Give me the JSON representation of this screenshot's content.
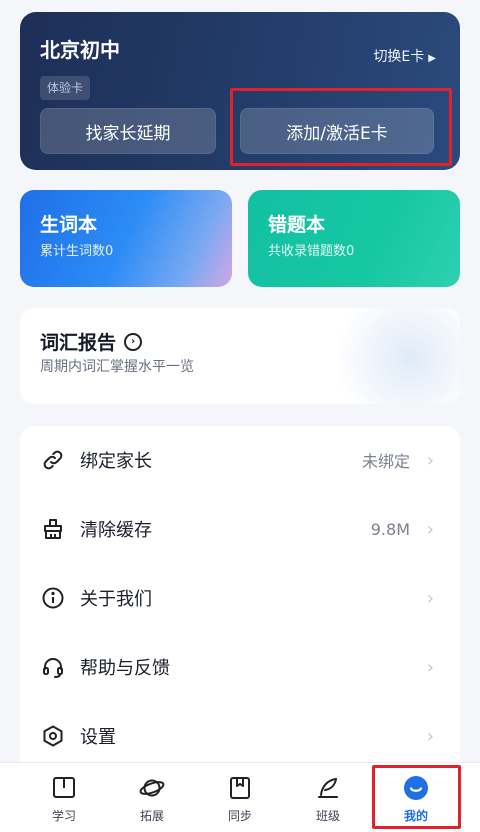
{
  "ecard": {
    "school_name": "北京初中",
    "card_type_tag": "体验卡",
    "switch_label": "切换E卡",
    "find_parent_extend_label": "找家长延期",
    "add_activate_label": "添加/激活E卡"
  },
  "books": {
    "vocab": {
      "title": "生词本",
      "subtitle": "累计生词数0"
    },
    "mistakes": {
      "title": "错题本",
      "subtitle": "共收录错题数0"
    }
  },
  "report": {
    "title": "词汇报告",
    "subtitle": "周期内词汇掌握水平一览"
  },
  "menu": [
    {
      "label": "绑定家长",
      "value": "未绑定",
      "icon": "link-icon"
    },
    {
      "label": "清除缓存",
      "value": "9.8M",
      "icon": "broom-icon"
    },
    {
      "label": "关于我们",
      "value": "",
      "icon": "info-icon"
    },
    {
      "label": "帮助与反馈",
      "value": "",
      "icon": "headset-icon"
    },
    {
      "label": "设置",
      "value": "",
      "icon": "hexagon-settings-icon"
    }
  ],
  "tabs": [
    {
      "label": "学习",
      "icon": "book-icon"
    },
    {
      "label": "拓展",
      "icon": "planet-icon"
    },
    {
      "label": "同步",
      "icon": "notebook-icon"
    },
    {
      "label": "班级",
      "icon": "quill-icon"
    },
    {
      "label": "我的",
      "icon": "profile-smile-icon",
      "active": true
    }
  ],
  "colors": {
    "card_dark": "#1d2f57",
    "vocab_blue": "#1f6fe6",
    "mistake_green": "#11c0a2",
    "highlight_red": "#e0222b",
    "active_tab": "#1f6fe6"
  }
}
